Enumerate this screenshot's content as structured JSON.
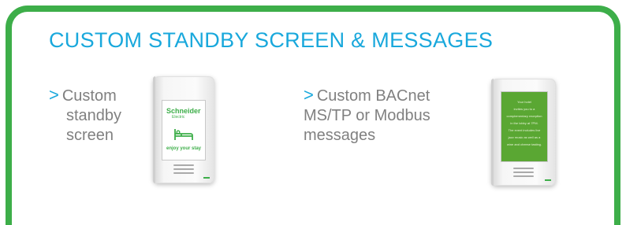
{
  "title": "CUSTOM STANDBY SCREEN & MESSAGES",
  "bullets": [
    {
      "marker": ">",
      "lines": [
        "Custom",
        "standby",
        "screen"
      ]
    },
    {
      "marker": ">",
      "lines": [
        "Custom BACnet",
        "MS/TP or Modbus",
        "messages"
      ]
    }
  ],
  "device_standby": {
    "logo_main": "Schneider",
    "logo_sub": "Electric",
    "tagline": "enjoy your stay",
    "icon": "bed-icon"
  },
  "device_message": {
    "message_lines": [
      "Your hotel",
      "invites you to a",
      "complementary reception",
      "in the lobby at 7PM.",
      "The event includes live",
      "jazz music as well as a",
      "wine and cheese tasting."
    ]
  },
  "colors": {
    "frame_green": "#3dae49",
    "title_blue": "#19a8dc",
    "text_gray": "#808080",
    "screen_green": "#5aa733"
  }
}
